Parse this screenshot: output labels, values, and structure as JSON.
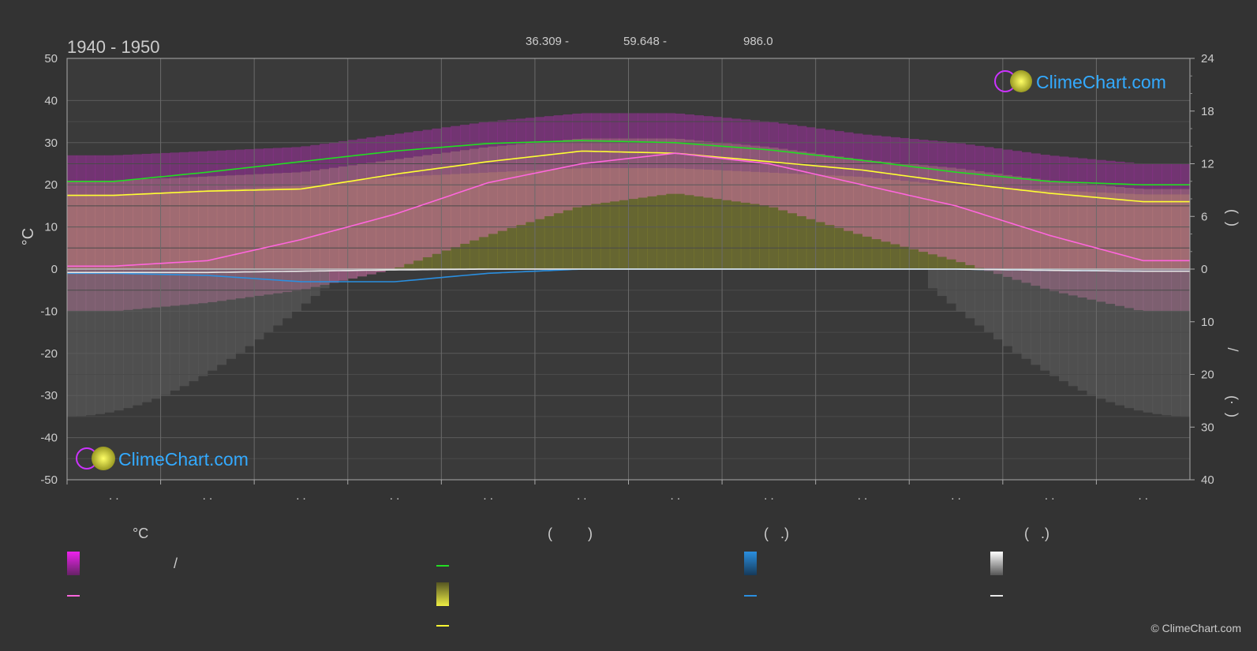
{
  "chart_data": {
    "type": "line",
    "title": "1940 - 1950",
    "subtitle_values": [
      "36.309 -",
      "59.648 -",
      "986.0"
    ],
    "ylabel_left": "°C",
    "ylabel_right_upper": "(  )",
    "ylabel_right_lower": "(·  )",
    "ylabel_right_slash": "/",
    "ylim_left": [
      -50,
      50
    ],
    "yticks_left": [
      50,
      40,
      30,
      20,
      10,
      0,
      -10,
      -20,
      -30,
      -40,
      -50
    ],
    "yticks_right_upper": [
      24,
      18,
      12,
      6,
      0
    ],
    "yticks_right_lower": [
      10,
      20,
      30,
      40
    ],
    "month_labels": [
      ". .",
      ". .",
      ". .",
      ". .",
      ". .",
      ". .",
      ". .",
      ". .",
      ". .",
      ". .",
      ". .",
      ". ."
    ],
    "x_months": [
      0.5,
      1.5,
      2.5,
      3.5,
      4.5,
      5.5,
      6.5,
      7.5,
      8.5,
      9.5,
      10.5,
      11.5
    ],
    "grid": true,
    "series": [
      {
        "color": "#22dd22",
        "values": [
          20.8,
          23.0,
          25.5,
          28.0,
          29.8,
          30.5,
          30.0,
          28.3,
          25.8,
          23.0,
          20.8,
          20.0
        ]
      },
      {
        "color": "#ffff33",
        "values": [
          17.5,
          18.5,
          19.0,
          22.5,
          25.5,
          28.0,
          27.5,
          25.5,
          23.5,
          20.5,
          18.0,
          16.0
        ]
      },
      {
        "color": "#ff66dd",
        "values": [
          0.7,
          2.0,
          7.0,
          13.0,
          20.5,
          25.0,
          27.5,
          25.0,
          20.0,
          15.0,
          8.0,
          2.0
        ]
      },
      {
        "color": "#2a8fe0",
        "values": [
          -1.0,
          -1.5,
          -3.0,
          -3.0,
          -1.0,
          0.0,
          0.0,
          0.0,
          0.0,
          0.0,
          -0.3,
          -0.5
        ]
      },
      {
        "color": "#e8e8e8",
        "values": [
          -0.8,
          -0.8,
          -0.5,
          -0.2,
          0.0,
          0.0,
          0.0,
          0.0,
          0.0,
          0.0,
          -0.3,
          -0.5
        ]
      }
    ],
    "sunshine_fill_hours": [
      8.5,
      9.0,
      9.5,
      10.5,
      11.0,
      11.5,
      11.5,
      11.0,
      10.5,
      9.5,
      9.0,
      8.5
    ],
    "temp_band_max": [
      18,
      19,
      20,
      23,
      26,
      28,
      28,
      26,
      23,
      21,
      18,
      16
    ],
    "temp_band_min": [
      -10,
      -8,
      -5,
      0,
      8,
      15,
      18,
      15,
      8,
      2,
      -5,
      -10
    ]
  },
  "logo": {
    "text": "ClimeChart.com"
  },
  "legend": {
    "col1": {
      "header": "°C",
      "row1": "/",
      "swatch_top": "#ee22ee",
      "line_color": "#ff66dd"
    },
    "col2": {
      "header": "(         )",
      "line1_color": "#22dd22",
      "swatch_color": "#eeee44",
      "line2_color": "#ffff33"
    },
    "col3": {
      "header": "(   .)",
      "swatch_color": "#2a8fe0",
      "line_color": "#2a8fe0"
    },
    "col4": {
      "header": "(   .)",
      "swatch_color": "#e8e8e8",
      "line_color": "#e8e8e8"
    }
  },
  "copyright": "© ClimeChart.com"
}
